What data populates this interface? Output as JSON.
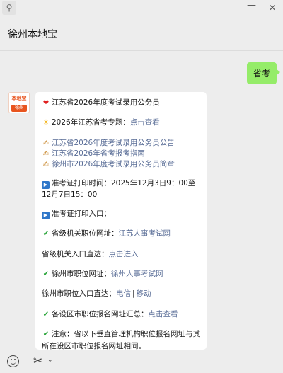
{
  "window": {
    "pin_icon": "pin-icon",
    "minimize_glyph": "—",
    "close_glyph": "✕"
  },
  "chat": {
    "title": "徐州本地宝"
  },
  "outgoing_message": {
    "text": "省考"
  },
  "avatar": {
    "brand_text": "本地宝",
    "city_text": "徐州"
  },
  "incoming_message": {
    "heading": "江苏省2026年度考试录用公务员",
    "topic_prefix": "2026年江苏省考专题：",
    "topic_link": "点击查看",
    "links": [
      "江苏省2026年度考试录用公务员公告",
      "江苏省2026年省考报考指南",
      "徐州市2026年度考试录用公务员简章"
    ],
    "print_time": "准考证打印时间：2025年12月3日9：00至12月7日15：00",
    "print_entry": "准考证打印入口：",
    "provincial_prefix": "省级机关职位网址：",
    "provincial_link": "江苏人事考试网",
    "provincial_entry_prefix": "省级机关入口直达：",
    "provincial_entry_link": "点击进入",
    "city_prefix": "徐州市职位网址：",
    "city_link": "徐州人事考试网",
    "city_entry_prefix": "徐州市职位入口直达：",
    "city_entry_link_1": "电信",
    "city_entry_sep": "|",
    "city_entry_link_2": "移动",
    "districts_prefix": "各设区市职位报名网址汇总：",
    "districts_link": "点击查看",
    "note": "注意：省以下垂直管理机构职位报名网址与其所在设区市职位报名网址相同。"
  },
  "toolbar": {
    "emoji_icon": "emoji-icon",
    "scissors_icon": "scissors-icon",
    "chevron_icon": "chevron-down-icon"
  },
  "colors": {
    "background": "#ededed",
    "outgoing_bubble": "#95ec69",
    "link": "#576b95",
    "check": "#2aa53a",
    "heart": "#e02020"
  }
}
